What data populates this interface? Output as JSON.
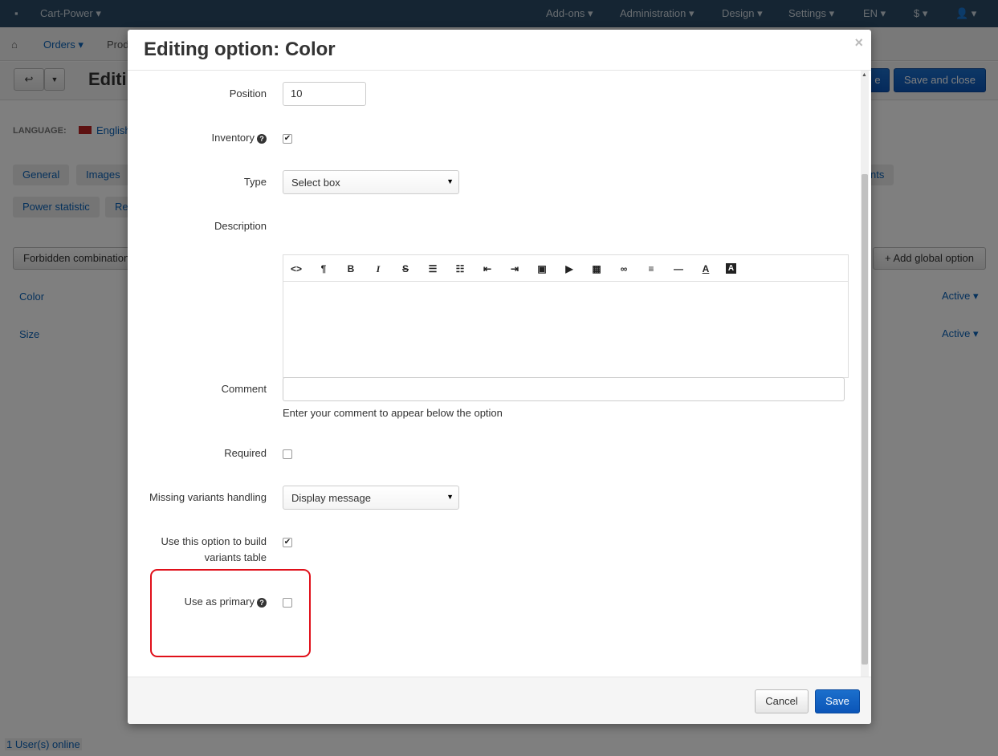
{
  "topbar": {
    "store": "Cart-Power",
    "addons": "Add-ons",
    "administration": "Administration",
    "design": "Design",
    "settings": "Settings",
    "language": "EN",
    "currency": "$"
  },
  "subbar": {
    "orders": "Orders",
    "products": "Prod"
  },
  "page": {
    "title": "Editi",
    "save_button": "Save and close",
    "save_partial": "e",
    "language_label": "LANGUAGE:",
    "language_value": "English",
    "tabs": [
      "General",
      "Images",
      "Power statistic",
      "Re",
      "nts"
    ],
    "forbidden": "Forbidden combination",
    "add_global": "Add global option",
    "options": [
      {
        "name": "Color",
        "status": "Active"
      },
      {
        "name": "Size",
        "status": "Active"
      }
    ],
    "users_online": "1 User(s) online"
  },
  "modal": {
    "title": "Editing option: Color",
    "close": "×",
    "fields": {
      "position_label": "Position",
      "position_value": "10",
      "inventory_label": "Inventory",
      "inventory_checked": true,
      "type_label": "Type",
      "type_value": "Select box",
      "description_label": "Description",
      "comment_label": "Comment",
      "comment_value": "",
      "comment_hint": "Enter your comment to appear below the option",
      "required_label": "Required",
      "required_checked": false,
      "missing_label": "Missing variants handling",
      "missing_value": "Display message",
      "variants_table_label_1": "Use this option to build",
      "variants_table_label_2": "variants table",
      "variants_table_checked": true,
      "primary_label": "Use as primary",
      "primary_checked": false
    },
    "editor_toolbar": [
      "code-icon",
      "paragraph-icon",
      "bold-icon",
      "italic-icon",
      "strikethrough-icon",
      "bullet-list-icon",
      "numbered-list-icon",
      "outdent-icon",
      "indent-icon",
      "image-icon",
      "video-icon",
      "table-icon",
      "link-icon",
      "align-icon",
      "horizontal-rule-icon",
      "font-color-icon",
      "background-color-icon"
    ],
    "cancel": "Cancel",
    "save": "Save",
    "help_glyph": "?",
    "check_glyph": "✔"
  },
  "colors": {
    "primary": "#0b55b8",
    "highlight": "#e0101a",
    "topbar": "#2b4a66"
  }
}
